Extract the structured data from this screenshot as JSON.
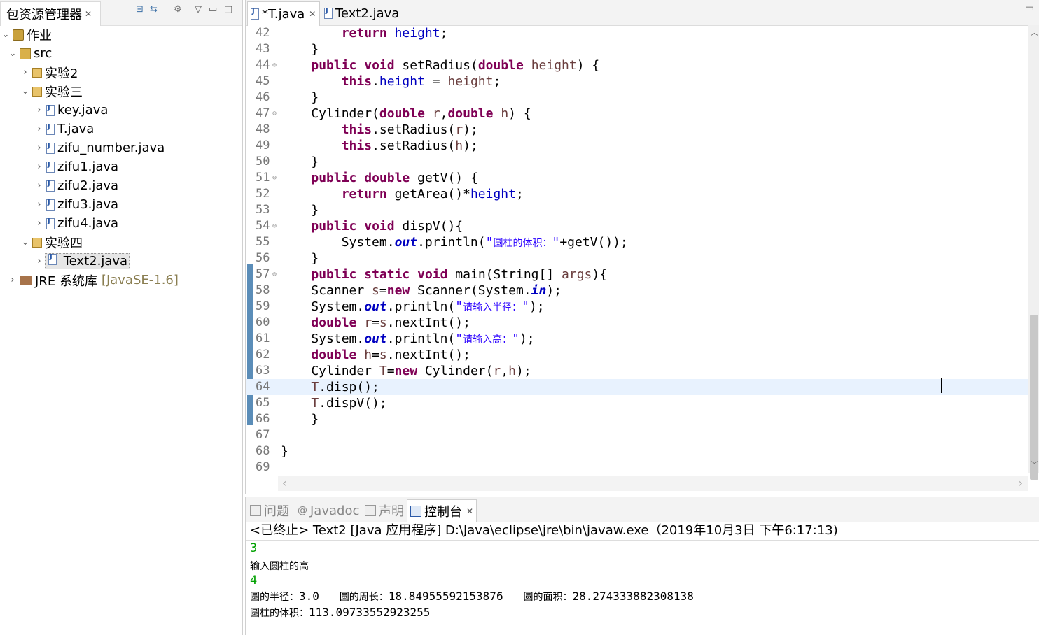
{
  "left_panel": {
    "tab_label": "包资源管理器",
    "tree": [
      {
        "label": "作业"
      },
      {
        "label": "src"
      },
      {
        "label": "实验2"
      },
      {
        "label": "实验三"
      },
      {
        "label": "key.java"
      },
      {
        "label": "T.java"
      },
      {
        "label": "zifu_number.java"
      },
      {
        "label": "zifu1.java"
      },
      {
        "label": "zifu2.java"
      },
      {
        "label": "zifu3.java"
      },
      {
        "label": "zifu4.java"
      },
      {
        "label": "实验四"
      },
      {
        "label": "Text2.java"
      },
      {
        "label": "JRE 系统库",
        "extra": "[JavaSE-1.6]"
      }
    ]
  },
  "editor": {
    "tabs": [
      {
        "label": "*T.java",
        "active": true
      },
      {
        "label": "Text2.java",
        "active": false
      }
    ],
    "lines": [
      {
        "n": "42"
      },
      {
        "n": "43"
      },
      {
        "n": "44"
      },
      {
        "n": "45"
      },
      {
        "n": "46"
      },
      {
        "n": "47"
      },
      {
        "n": "48"
      },
      {
        "n": "49"
      },
      {
        "n": "50"
      },
      {
        "n": "51"
      },
      {
        "n": "52"
      },
      {
        "n": "53"
      },
      {
        "n": "54"
      },
      {
        "n": "55"
      },
      {
        "n": "56"
      },
      {
        "n": "57"
      },
      {
        "n": "58"
      },
      {
        "n": "59"
      },
      {
        "n": "60"
      },
      {
        "n": "61"
      },
      {
        "n": "62"
      },
      {
        "n": "63"
      },
      {
        "n": "64"
      },
      {
        "n": "65"
      },
      {
        "n": "66"
      },
      {
        "n": "67"
      },
      {
        "n": "68"
      },
      {
        "n": "69"
      }
    ]
  },
  "bottom_panel": {
    "tabs": [
      {
        "label": "问题"
      },
      {
        "label": "Javadoc"
      },
      {
        "label": "声明"
      },
      {
        "label": "控制台"
      }
    ],
    "console_header": "<已终止> Text2 [Java 应用程序] D:\\Java\\eclipse\\jre\\bin\\javaw.exe（2019年10月3日 下午6:17:13)",
    "output": {
      "l1": "3",
      "l2": "输入圆柱的高",
      "l3": "4",
      "l4_a": "圆的半径：",
      "l4_b": "3.0",
      "l4_c": "圆的周长：",
      "l4_d": "18.84955592153876",
      "l4_e": "圆的面积：",
      "l4_f": "28.274333882308138",
      "l5_a": "圆柱的体积：",
      "l5_b": "113.09733552923255"
    }
  },
  "colors": {
    "keyword": "#7f0055",
    "field": "#0000c0",
    "string": "#2a00ff",
    "current_line": "#e8f2fe",
    "console_input": "#00a000"
  }
}
